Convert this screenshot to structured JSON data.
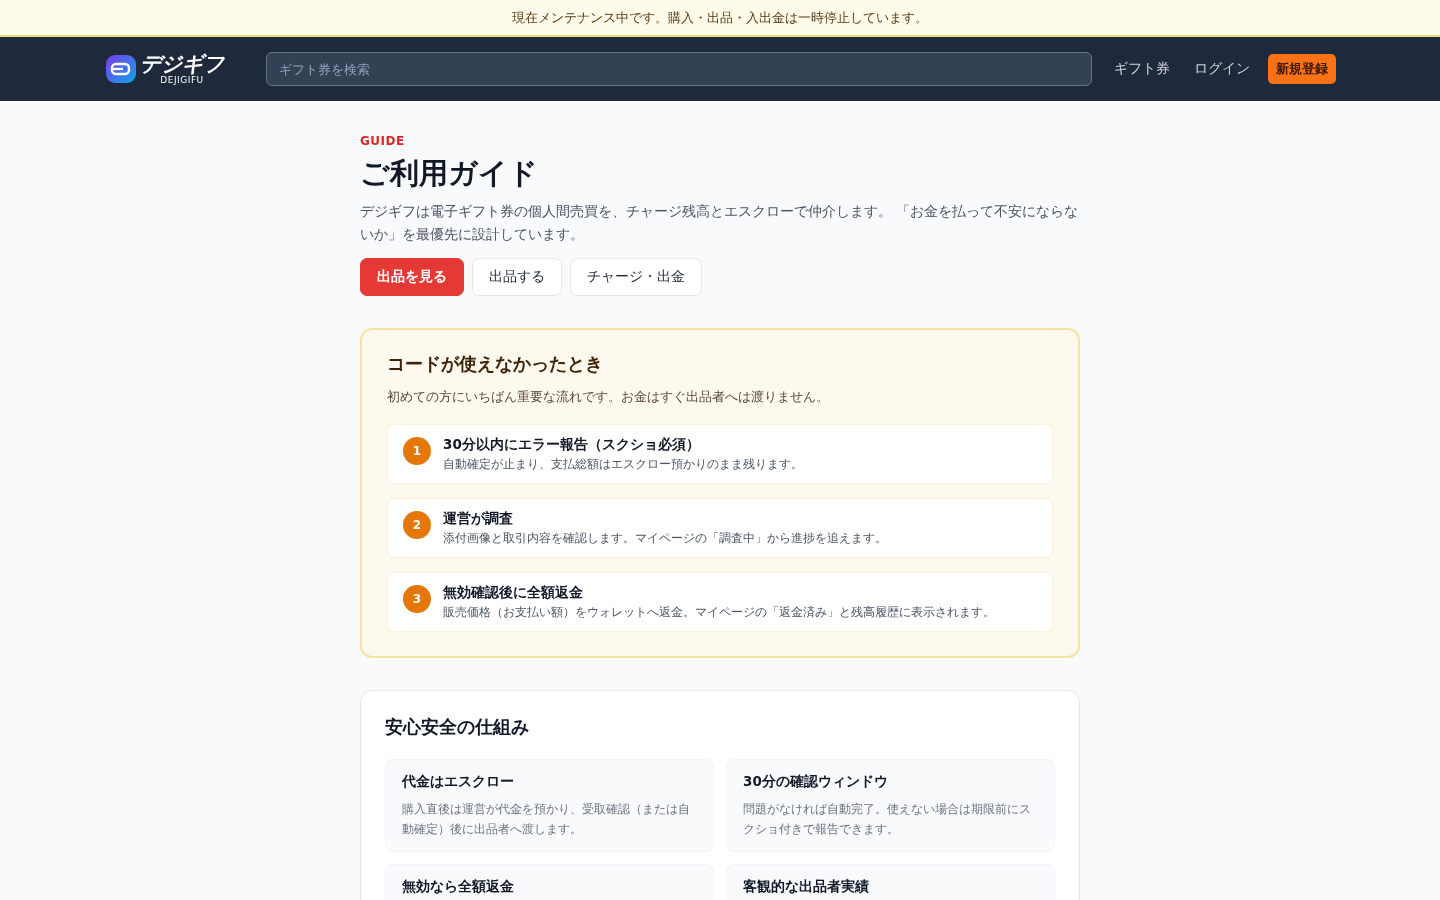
{
  "notice": "現在メンテナンス中です。購入・出品・入出金は一時停止しています。",
  "header": {
    "logo": {
      "name": "デジギフ",
      "subtitle": "DEJIGIFU"
    },
    "search": {
      "placeholder": "ギフト券を検索"
    },
    "nav": [
      {
        "label": "ギフト券",
        "kind": "link"
      },
      {
        "label": "ログイン",
        "kind": "link"
      },
      {
        "label": "新規登録",
        "kind": "cta"
      }
    ]
  },
  "hero": {
    "eyebrow": "GUIDE",
    "title": "ご利用ガイド",
    "description": "デジギフは電子ギフト券の個人間売買を、チャージ残高とエスクローで仲介します。 「お金を払って不安にならないか」を最優先に設計しています。",
    "buttons": [
      {
        "label": "出品を見る",
        "kind": "primary"
      },
      {
        "label": "出品する",
        "kind": "secondary"
      },
      {
        "label": "チャージ・出金",
        "kind": "secondary"
      }
    ]
  },
  "trouble": {
    "title": "コードが使えなかったとき",
    "lead": "初めての方にいちばん重要な流れです。お金はすぐ出品者へは渡りません。",
    "steps": [
      {
        "number": "1",
        "title": "30分以内にエラー報告（スクショ必須）",
        "text": "自動確定が止まり、支払総額はエスクロー預かりのまま残ります。"
      },
      {
        "number": "2",
        "title": "運営が調査",
        "text": "添付画像と取引内容を確認します。マイページの「調査中」から進捗を追えます。"
      },
      {
        "number": "3",
        "title": "無効確認後に全額返金",
        "text": "販売価格（お支払い額）をウォレットへ返金。マイページの「返金済み」と残高履歴に表示されます。"
      }
    ]
  },
  "safety": {
    "title": "安心安全の仕組み",
    "cards": [
      {
        "title": "代金はエスクロー",
        "text": "購入直後は運営が代金を預かり、受取確認（または自動確定）後に出品者へ渡します。"
      },
      {
        "title": "30分の確認ウィンドウ",
        "text": "問題がなければ自動完了。使えない場合は期限前にスクショ付きで報告できます。"
      },
      {
        "title": "無効なら全額返金"
      },
      {
        "title": "客観的な出品者実績"
      }
    ]
  }
}
